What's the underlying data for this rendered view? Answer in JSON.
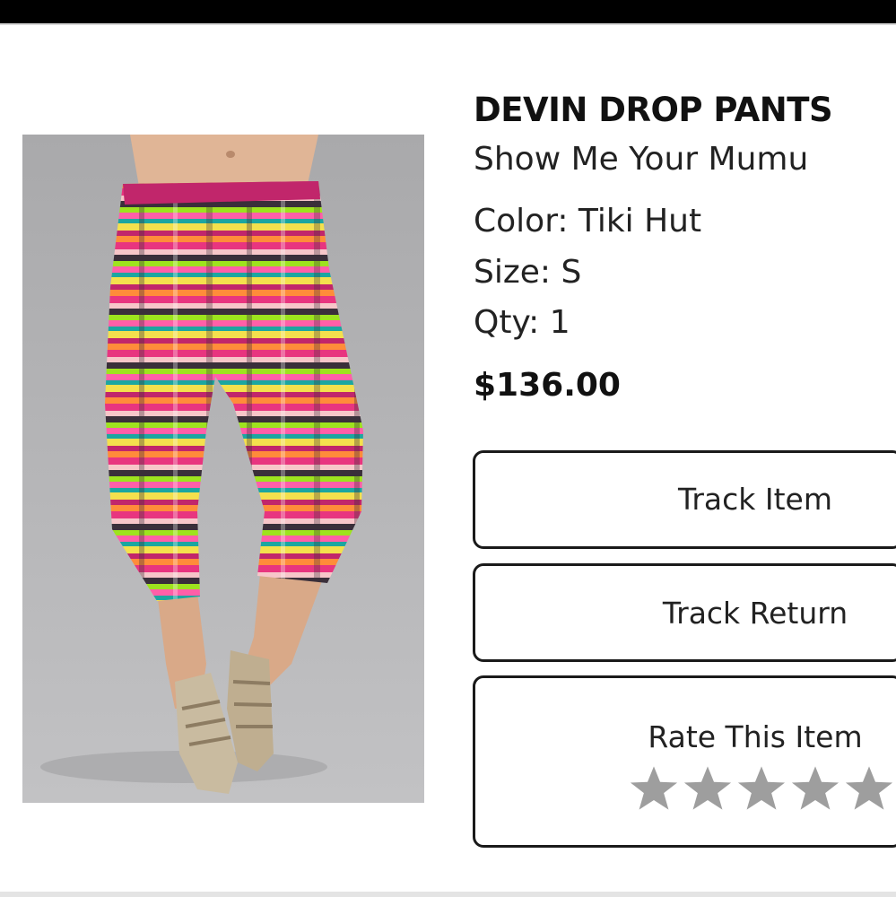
{
  "product": {
    "title": "DEVIN DROP PANTS",
    "brand": "Show Me Your Mumu",
    "color_label": "Color: Tiki Hut",
    "size_label": "Size: S",
    "qty_label": "Qty: 1",
    "price": "$136.00"
  },
  "actions": {
    "track_item_label": "Track Item",
    "track_return_label": "Track Return",
    "rate_label": "Rate This Item"
  },
  "rating": {
    "max_stars": 5,
    "selected": 0,
    "star_color": "#9e9e9e"
  },
  "colors": {
    "top_bar": "#000000",
    "button_border": "#1a1a1a",
    "text": "#222222"
  }
}
